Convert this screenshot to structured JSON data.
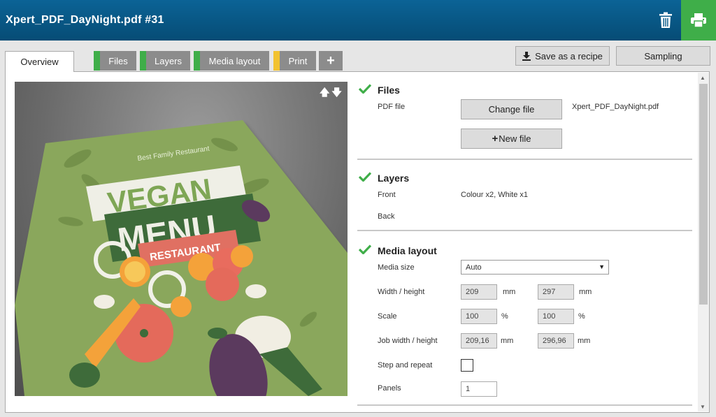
{
  "header": {
    "title": "Xpert_PDF_DayNight.pdf #31"
  },
  "tabs": [
    {
      "label": "Overview"
    },
    {
      "label": "Files",
      "stripe": "#3fae49"
    },
    {
      "label": "Layers",
      "stripe": "#3fae49"
    },
    {
      "label": "Media layout",
      "stripe": "#3fae49"
    },
    {
      "label": "Print",
      "stripe": "#f2c230"
    }
  ],
  "toolbar": {
    "save_recipe": "Save as a recipe",
    "sampling": "Sampling"
  },
  "preview": {
    "tagline": "Best Family Restaurant",
    "word1": "VEGAN",
    "word2": "MENU",
    "word3": "RESTAURANT"
  },
  "files": {
    "title": "Files",
    "pdf_label": "PDF file",
    "change_button": "Change file",
    "new_button": "New file",
    "filename": "Xpert_PDF_DayNight.pdf"
  },
  "layers": {
    "title": "Layers",
    "front_label": "Front",
    "front_value": "Colour x2, White x1",
    "back_label": "Back"
  },
  "media": {
    "title": "Media layout",
    "size_label": "Media size",
    "size_value": "Auto",
    "wh_label": "Width / height",
    "width": "209",
    "height": "297",
    "unit_mm": "mm",
    "scale_label": "Scale",
    "scale_x": "100",
    "scale_y": "100",
    "unit_pct": "%",
    "job_label": "Job width / height",
    "job_w": "209,16",
    "job_h": "296,96",
    "step_label": "Step and repeat",
    "panels_label": "Panels",
    "panels_value": "1"
  },
  "colors": {
    "header": "#0b6396",
    "print_button": "#3fae49",
    "check": "#3fae49",
    "print_tab_stripe": "#f2c230"
  }
}
